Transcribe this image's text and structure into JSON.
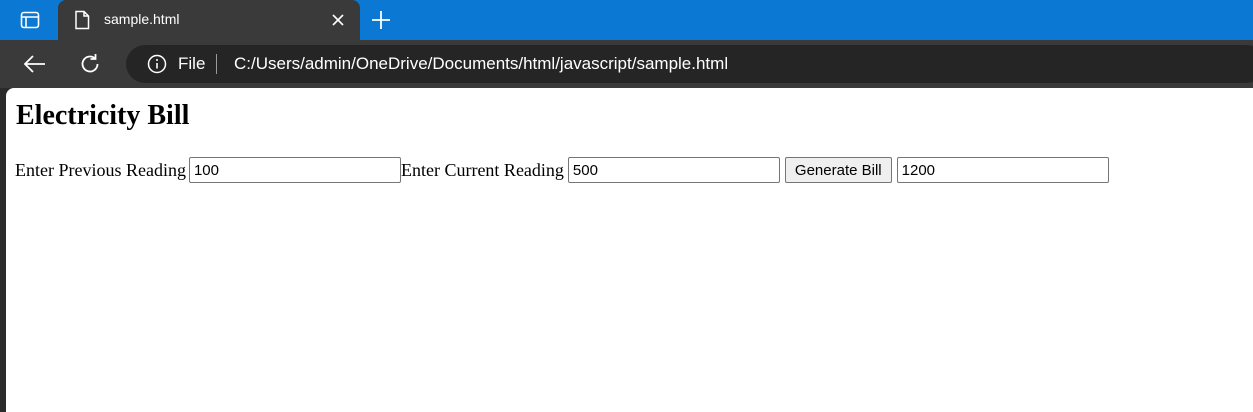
{
  "browser": {
    "tab_title": "sample.html",
    "address_scheme_label": "File",
    "url": "C:/Users/admin/OneDrive/Documents/html/javascript/sample.html",
    "colors": {
      "tabstrip": "#0b78d4",
      "toolbar": "#3a3a3a",
      "omnibox": "#252525"
    }
  },
  "page": {
    "title": "Electricity Bill",
    "previous_label": "Enter Previous Reading",
    "previous_value": "100",
    "current_label": "Enter Current Reading",
    "current_value": "500",
    "generate_label": "Generate Bill",
    "result_value": "1200"
  }
}
